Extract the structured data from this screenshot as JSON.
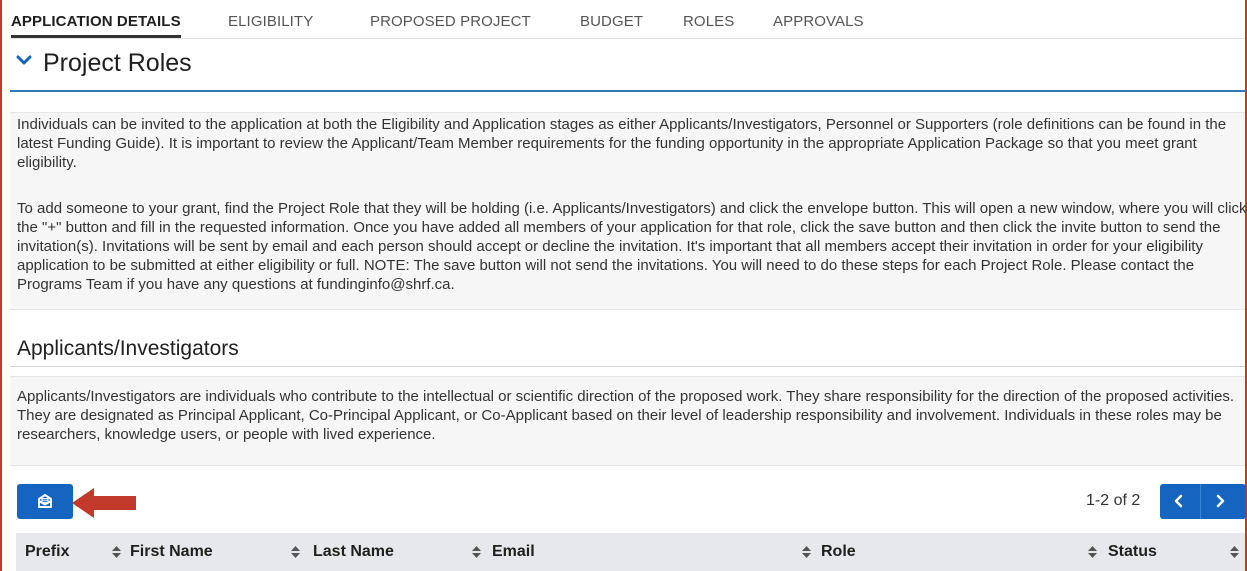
{
  "tabs": [
    {
      "label": "APPLICATION DETAILS",
      "active": true
    },
    {
      "label": "ELIGIBILITY"
    },
    {
      "label": "PROPOSED PROJECT"
    },
    {
      "label": "BUDGET"
    },
    {
      "label": "ROLES"
    },
    {
      "label": "APPROVALS"
    }
  ],
  "section": {
    "title": "Project Roles",
    "icon": "chevron-down-icon"
  },
  "intro": {
    "paragraph1": "Individuals can be invited to the application at both the Eligibility and Application stages as either Applicants/Investigators, Personnel or Supporters (role definitions can be found in the latest Funding Guide). It is important to review the Applicant/Team Member requirements for the funding opportunity in the appropriate Application Package so that you meet grant eligibility.",
    "paragraph2": "To add someone to your grant, find the Project Role that they will be holding (i.e. Applicants/Investigators) and click the envelope button. This will open a new window, where you will click the \"+\" button and fill in the requested information. Once you have added all members of your application for that role, click the save button and then click the invite button to send the invitation(s). Invitations will be sent by email and each person should accept or decline the invitation. It's important that all members accept their invitation in order for your eligibility application to be submitted at either eligibility or full. NOTE: The save button will not send the invitations. You will need to do these steps for each Project Role. Please contact the Programs Team if you have any questions at fundinginfo@shrf.ca."
  },
  "role_group": {
    "title": "Applicants/Investigators",
    "description": "Applicants/Investigators are individuals who contribute to the intellectual or scientific direction of the proposed work. They share responsibility for the direction of the proposed activities. They are designated as Principal Applicant, Co-Principal Applicant, or Co-Applicant based on their level of leadership responsibility and involvement. Individuals in these roles may be researchers, knowledge users, or people with lived experience."
  },
  "toolbar": {
    "invite_icon": "envelope-icon",
    "pager_text": "1-2 of 2",
    "prev_icon": "chevron-left-icon",
    "next_icon": "chevron-right-icon"
  },
  "table": {
    "columns": [
      "Prefix",
      "First Name",
      "Last Name",
      "Email",
      "Role",
      "Status"
    ]
  },
  "colors": {
    "accent": "#1565c0",
    "section_rule": "#2d7bb8",
    "annotation_arrow": "#c0392b",
    "frame": "#c0392b"
  }
}
